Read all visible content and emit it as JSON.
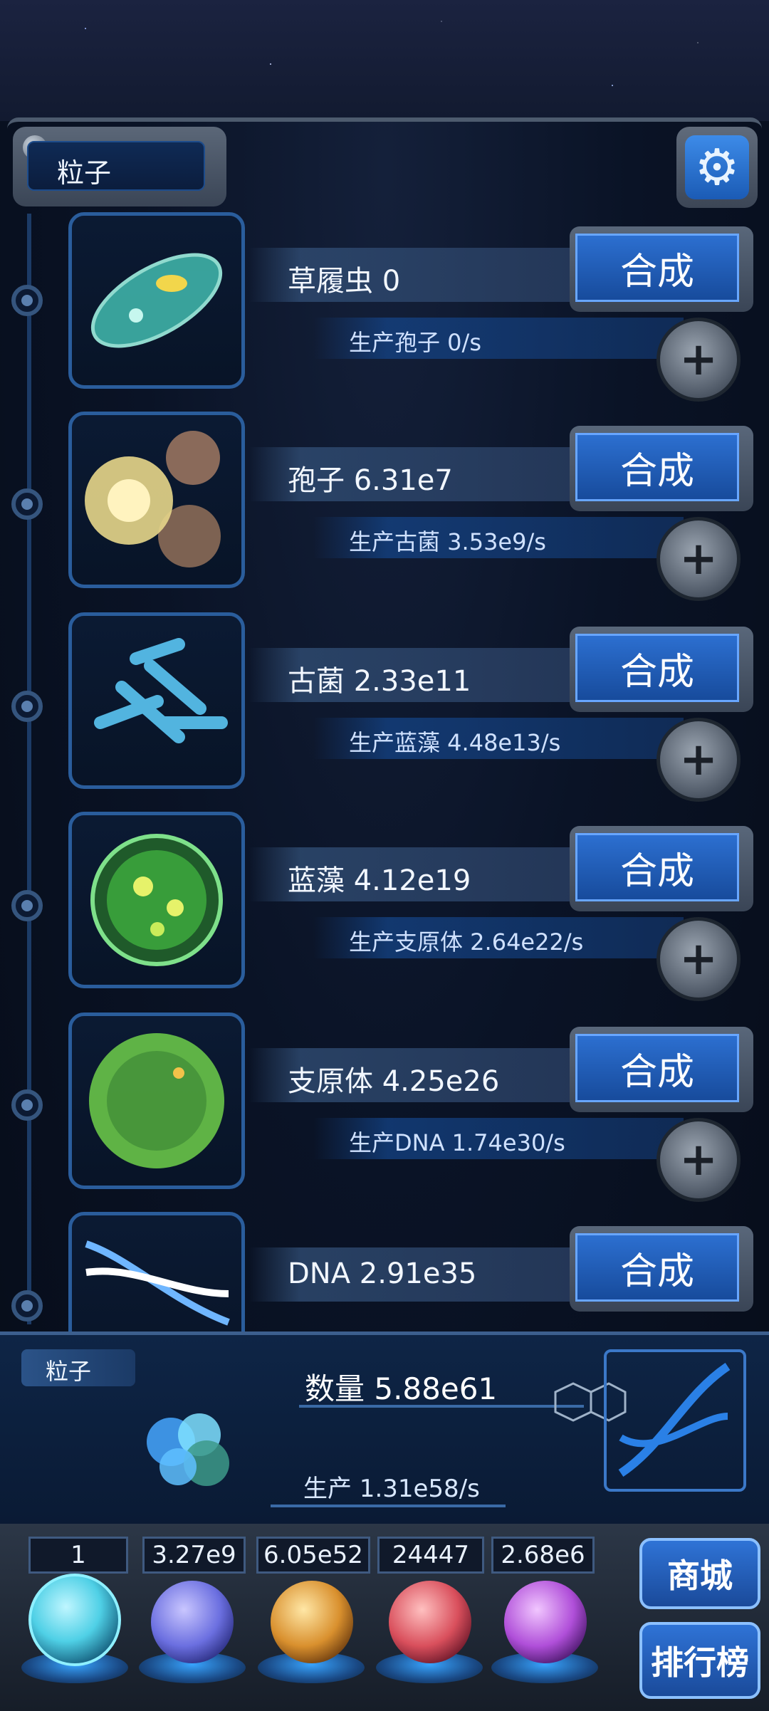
{
  "header": {
    "title": "粒子",
    "settings_icon": "gear-icon"
  },
  "rows": [
    {
      "name": "草履虫 0",
      "production": "生产孢子 0/s",
      "craft_label": "合成",
      "icon": "paramecium-icon"
    },
    {
      "name": "孢子 6.31e7",
      "production": "生产古菌 3.53e9/s",
      "craft_label": "合成",
      "icon": "spore-icon"
    },
    {
      "name": "古菌 2.33e11",
      "production": "生产蓝藻 4.48e13/s",
      "craft_label": "合成",
      "icon": "archaea-icon"
    },
    {
      "name": "蓝藻 4.12e19",
      "production": "生产支原体 2.64e22/s",
      "craft_label": "合成",
      "icon": "cyanobacteria-icon"
    },
    {
      "name": "支原体 4.25e26",
      "production": "生产DNA 1.74e30/s",
      "craft_label": "合成",
      "icon": "mycoplasma-icon"
    },
    {
      "name": "DNA 2.91e35",
      "production": "",
      "craft_label": "合成",
      "icon": "dna-icon"
    }
  ],
  "summary": {
    "tab": "粒子",
    "quantity": "数量 5.88e61",
    "production": "生产 1.31e58/s"
  },
  "resources": [
    {
      "value": "1",
      "icon": "particle-orb-icon",
      "color": "#4fd0e6"
    },
    {
      "value": "3.27e9",
      "icon": "lightning-orb-icon",
      "color": "#6b6fe0"
    },
    {
      "value": "6.05e52",
      "icon": "fire-orb-icon",
      "color": "#d9902e"
    },
    {
      "value": "24447",
      "icon": "brain-orb-icon",
      "color": "#d94f5c"
    },
    {
      "value": "2.68e6",
      "icon": "vortex-orb-icon",
      "color": "#b04fd9"
    }
  ],
  "side_buttons": {
    "shop": "商城",
    "ranking": "排行榜"
  }
}
